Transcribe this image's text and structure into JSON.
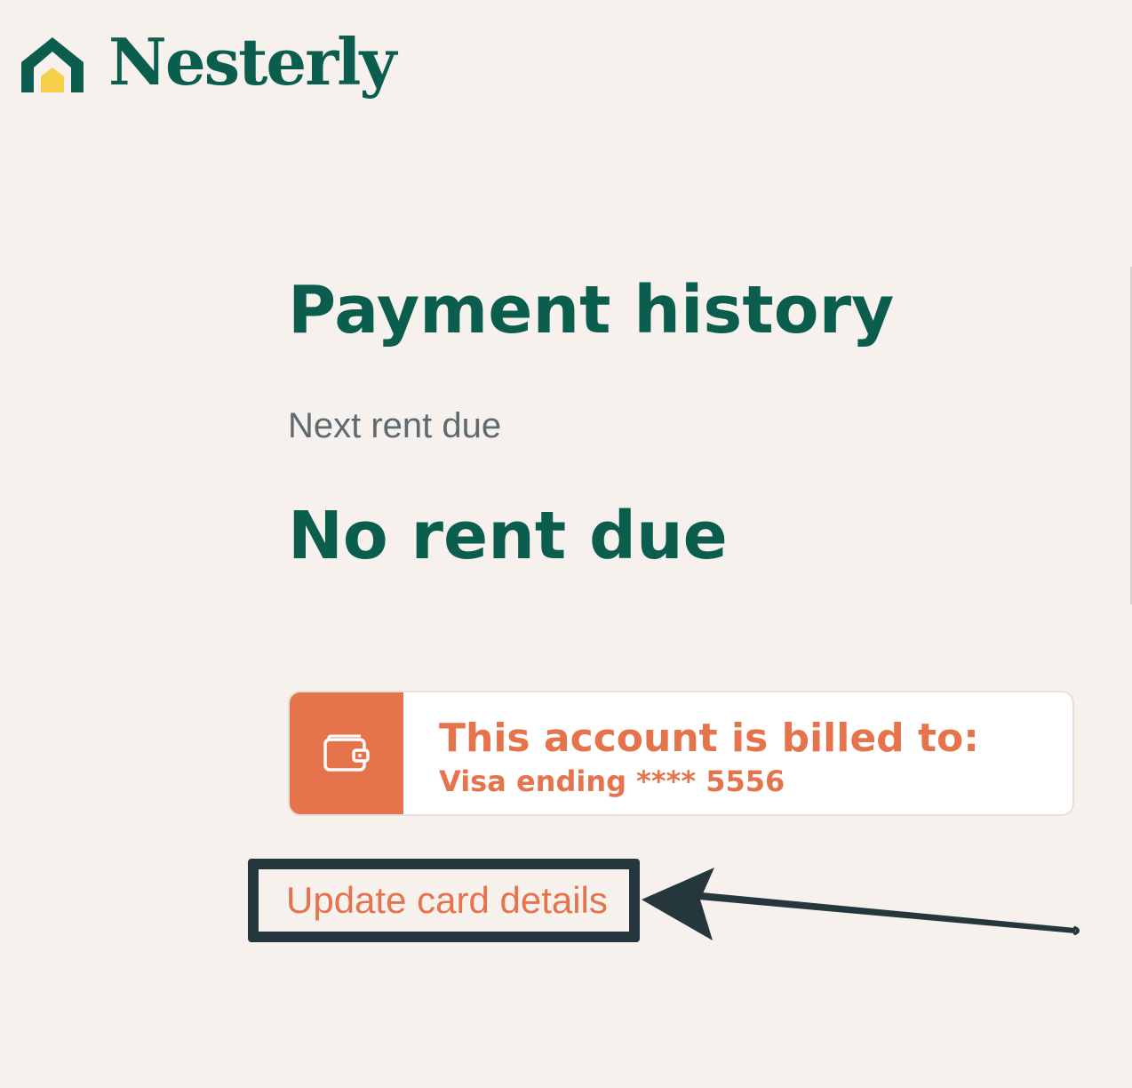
{
  "brand": {
    "name": "Nesterly",
    "color_primary": "#0b5e4d",
    "color_house_door": "#f5cf48"
  },
  "page": {
    "title": "Payment history",
    "next_rent_label": "Next rent due",
    "rent_status": "No rent due",
    "title_color": "#0b5e4d",
    "label_color": "#5f6a70"
  },
  "billing": {
    "heading": "This account is billed to:",
    "card_text": "Visa ending **** 5556",
    "icon": "wallet-icon",
    "accent_color": "#e5744c"
  },
  "update_card": {
    "label": "Update card details",
    "color": "#e5744c"
  },
  "annotation": {
    "color": "#26363d"
  }
}
